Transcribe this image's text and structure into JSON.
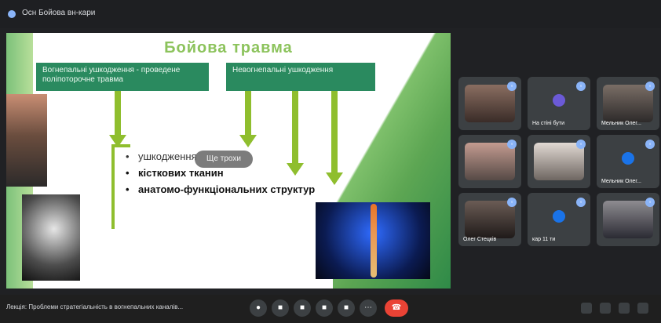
{
  "top": {
    "meeting_title": "Осн Бойова вн-кари"
  },
  "slide": {
    "title": "Бойова травма",
    "box_left": "Вогнепальні ушкодження - проведене поліпоторочне травма",
    "box_right": "Невогнепальні ушкодження",
    "bullet1": "ушкодження",
    "bubble": "Ще трохи",
    "bullet2": "кісткових тканин",
    "bullet3": "анатомо-функціональних структур"
  },
  "participants": [
    {
      "name": "",
      "mic": "◦"
    },
    {
      "name": "На стіні бути",
      "mic": "◦"
    },
    {
      "name": "Мельник Олег...",
      "mic": "◦"
    },
    {
      "name": "",
      "mic": "◦"
    },
    {
      "name": "",
      "mic": "◦"
    },
    {
      "name": "Мельник Олег...",
      "mic": "◦"
    },
    {
      "name": "Олег Стецків",
      "mic": "◦"
    },
    {
      "name": "кар 11 ти",
      "mic": "◦"
    },
    {
      "name": "",
      "mic": "◦"
    }
  ],
  "bottom": {
    "presentation_text": "Лекція: Проблеми стратегіальність в вогнепальних каналів..."
  },
  "controls": {
    "b1": "●",
    "b2": "■",
    "b3": "■",
    "b4": "■",
    "b5": "■",
    "b6": "●",
    "b7": "⋯",
    "hang": "☎"
  }
}
